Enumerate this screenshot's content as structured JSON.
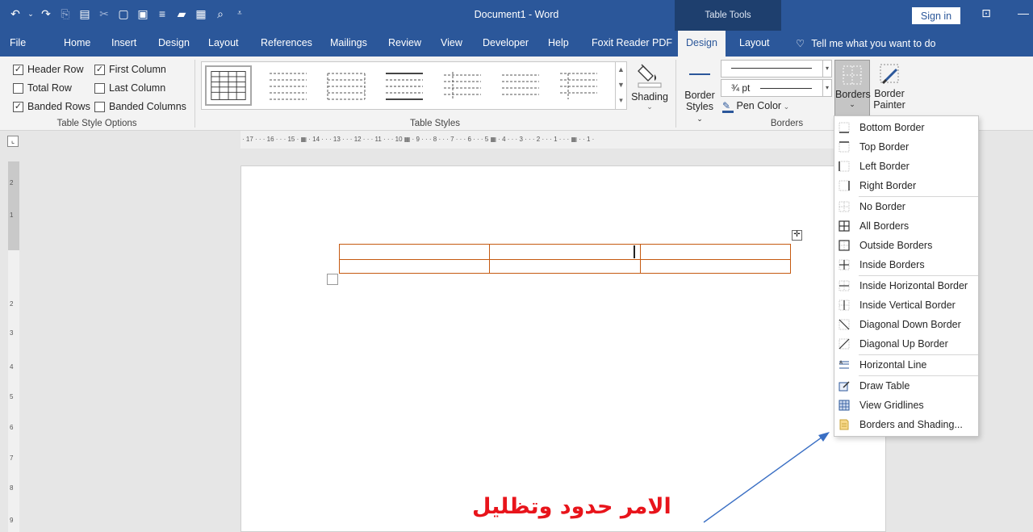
{
  "title_bar": {
    "document_title": "Document1  -  Word",
    "context_label": "Table Tools",
    "sign_in": "Sign in"
  },
  "tabs": [
    "File",
    "Home",
    "Insert",
    "Design",
    "Layout",
    "References",
    "Mailings",
    "Review",
    "View",
    "Developer",
    "Help",
    "Foxit Reader PDF"
  ],
  "context_tabs": {
    "design": "Design",
    "layout": "Layout"
  },
  "tell_me": "Tell me what you want to do",
  "table_style_options": {
    "label": "Table Style Options",
    "options": [
      {
        "label": "Header Row",
        "checked": true
      },
      {
        "label": "First Column",
        "checked": true
      },
      {
        "label": "Total Row",
        "checked": false
      },
      {
        "label": "Last Column",
        "checked": false
      },
      {
        "label": "Banded Rows",
        "checked": true
      },
      {
        "label": "Banded Columns",
        "checked": false
      }
    ]
  },
  "table_styles": {
    "label": "Table Styles",
    "shading": "Shading"
  },
  "borders_group": {
    "label": "Borders",
    "border_styles": "Border",
    "border_styles_2": "Styles",
    "line_weight": "¾ pt",
    "pen_color": "Pen Color",
    "borders_button": "Borders",
    "border_painter_1": "Border",
    "border_painter_2": "Painter"
  },
  "ruler_text": "· 17 · · · 16 · · · 15 · ▦ · 14 · · · 13 · · · 12 · · · 11 · · · 10 ▦ · 9 · · · 8 · · · 7 · · · 6 · · · 5 ▦ · 4 · · · 3 · · · 2 · · · 1 · · · ▦ · · 1 ·",
  "vertical_ruler": [
    "2",
    "1",
    "2",
    "3",
    "4",
    "5",
    "6",
    "7",
    "8",
    "9"
  ],
  "borders_menu": [
    {
      "label": "Bottom Border",
      "icon": "bottom-border-icon"
    },
    {
      "label": "Top Border",
      "icon": "top-border-icon"
    },
    {
      "label": "Left Border",
      "icon": "left-border-icon"
    },
    {
      "label": "Right Border",
      "icon": "right-border-icon"
    },
    {
      "label": "No Border",
      "icon": "no-border-icon"
    },
    {
      "label": "All Borders",
      "icon": "all-borders-icon"
    },
    {
      "label": "Outside Borders",
      "icon": "outside-borders-icon"
    },
    {
      "label": "Inside Borders",
      "icon": "inside-borders-icon"
    },
    {
      "label": "Inside Horizontal Border",
      "icon": "inside-horizontal-border-icon"
    },
    {
      "label": "Inside Vertical Border",
      "icon": "inside-vertical-border-icon"
    },
    {
      "label": "Diagonal Down Border",
      "icon": "diagonal-down-border-icon"
    },
    {
      "label": "Diagonal Up Border",
      "icon": "diagonal-up-border-icon"
    },
    {
      "label": "Horizontal Line",
      "icon": "horizontal-line-icon"
    },
    {
      "label": "Draw Table",
      "icon": "draw-table-icon"
    },
    {
      "label": "View Gridlines",
      "icon": "view-gridlines-icon"
    },
    {
      "label": "Borders and Shading...",
      "icon": "borders-and-shading-icon"
    }
  ],
  "annotation": "الامر حدود وتظليل",
  "colors": {
    "brand": "#2b579a",
    "table_border": "#c55a11",
    "annotation": "#e8141b",
    "arrow": "#3a6fc4"
  }
}
